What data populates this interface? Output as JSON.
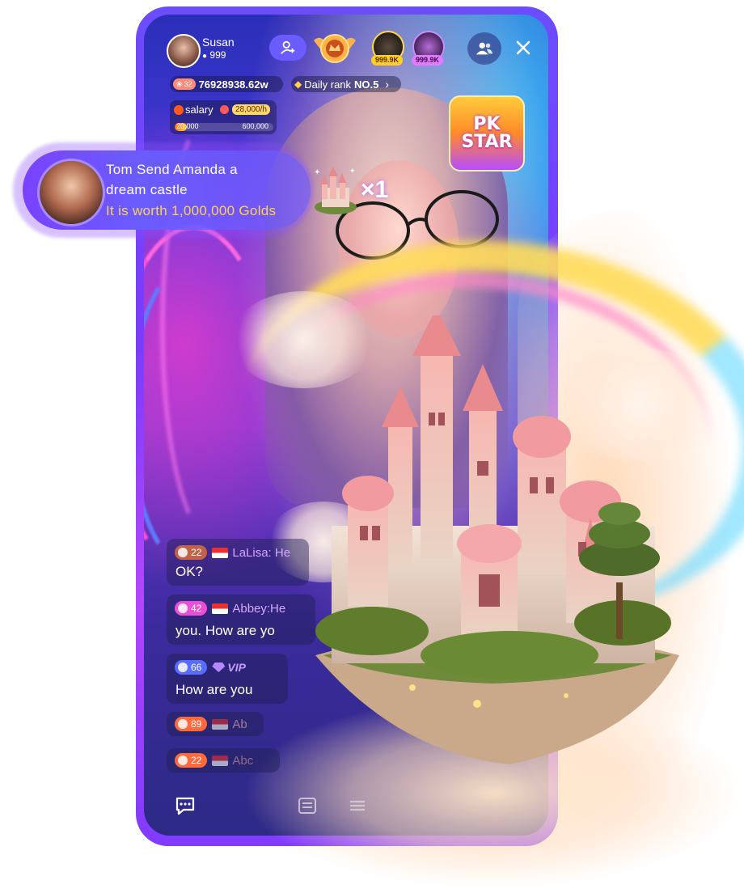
{
  "host": {
    "name": "Susan",
    "fans": "999"
  },
  "stats": {
    "level": "32",
    "golds": "76928938.62w",
    "daily_rank_label": "Daily rank",
    "daily_rank_value": "NO.5"
  },
  "salary": {
    "label": "salary",
    "rate": "28,000/h",
    "current": "20,000",
    "target": "600,000",
    "progress_fraction": 0.12
  },
  "top_viewers": [
    {
      "count": "999.9K"
    },
    {
      "count": "999.9K"
    }
  ],
  "pk_badge": {
    "line1": "PK",
    "line2": "STAR"
  },
  "gift_notification": {
    "line1": "Tom Send Amanda a",
    "line2": "dream castle",
    "line3": "It is worth 1,000,000 Golds",
    "multiplier": "×1"
  },
  "chat": [
    {
      "level": "22",
      "level_color": "#c0634a",
      "name": "LaLisa: He",
      "text": "OK?"
    },
    {
      "level": "42",
      "level_color": "#e84fd6",
      "name": "Abbey:He",
      "text": "you. How are yo"
    },
    {
      "level": "66",
      "level_color": "#5a6bff",
      "badge": "VIP",
      "name": "",
      "text": "How are you"
    },
    {
      "level": "89",
      "level_color": "#ff6a3d",
      "name": "Ab",
      "text": ""
    },
    {
      "level": "22",
      "level_color": "#ff6a3d",
      "name": "Abc",
      "text": ""
    }
  ],
  "colors": {
    "accent": "#6a5cff",
    "frame": "#7a3cff",
    "gold": "#ffd24a"
  },
  "icons": {
    "follow": "add-user-icon",
    "users": "users-icon",
    "close": "close-icon",
    "chat": "chat-icon",
    "menu": "menu-icon"
  }
}
